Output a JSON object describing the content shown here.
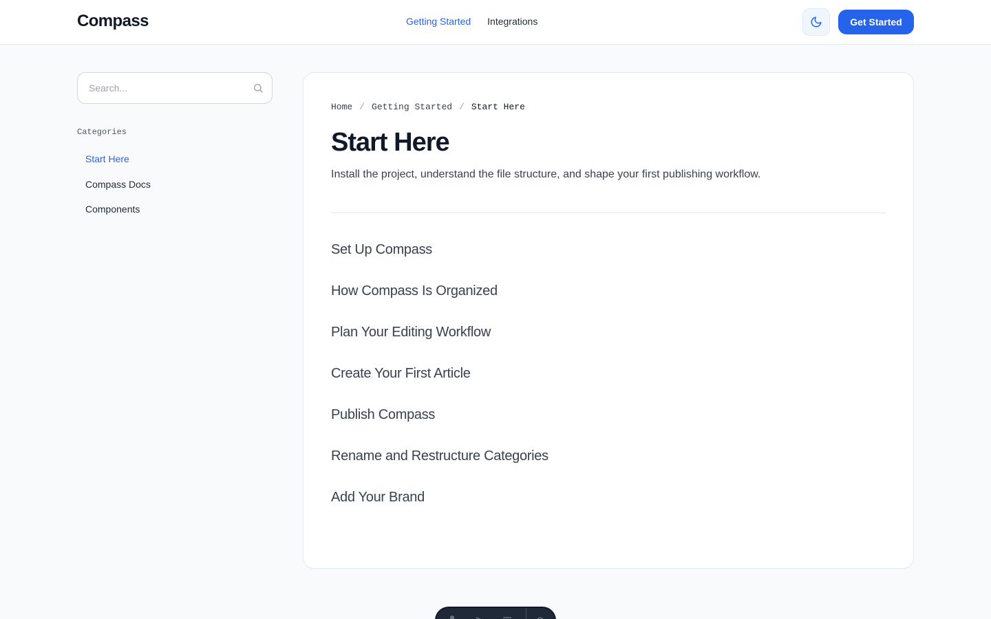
{
  "header": {
    "brand": "Compass",
    "nav": [
      {
        "label": "Getting Started",
        "active": true
      },
      {
        "label": "Integrations",
        "active": false
      }
    ],
    "theme_toggle_icon": "moon-icon",
    "cta_label": "Get Started"
  },
  "sidebar": {
    "search": {
      "placeholder": "Search...",
      "value": "",
      "icon": "search-icon"
    },
    "categories_heading": "Categories",
    "categories": [
      {
        "label": "Start Here",
        "active": true
      },
      {
        "label": "Compass Docs",
        "active": false
      },
      {
        "label": "Components",
        "active": false
      }
    ]
  },
  "main": {
    "breadcrumb": {
      "home": "Home",
      "section": "Getting Started",
      "current": "Start Here",
      "separator": "/"
    },
    "title": "Start Here",
    "description": "Install the project, understand the file structure, and shape your first publishing workflow.",
    "articles": [
      "Set Up Compass",
      "How Compass Is Organized",
      "Plan Your Editing Workflow",
      "Create Your First Article",
      "Publish Compass",
      "Rename and Restructure Categories",
      "Add Your Brand"
    ]
  },
  "colors": {
    "accent": "#2563eb",
    "background": "#f8fafc",
    "text": "#1f2937"
  }
}
